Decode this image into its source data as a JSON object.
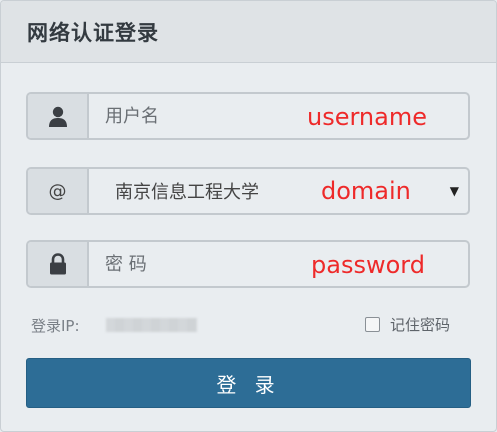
{
  "header": {
    "title": "网络认证登录"
  },
  "username": {
    "icon": "user-icon",
    "placeholder": "用户名",
    "annotation": "username"
  },
  "domain": {
    "addon_symbol": "@",
    "selected": "南京信息工程大学",
    "arrow": "▼",
    "annotation": "domain"
  },
  "password": {
    "icon": "lock-icon",
    "placeholder": "密 码",
    "annotation": "password"
  },
  "footer": {
    "ip_label": "登录IP:",
    "remember_label": "记住密码"
  },
  "submit": {
    "label": "登 录"
  },
  "colors": {
    "annotation": "#ee2a2a",
    "button": "#2d6d96"
  }
}
